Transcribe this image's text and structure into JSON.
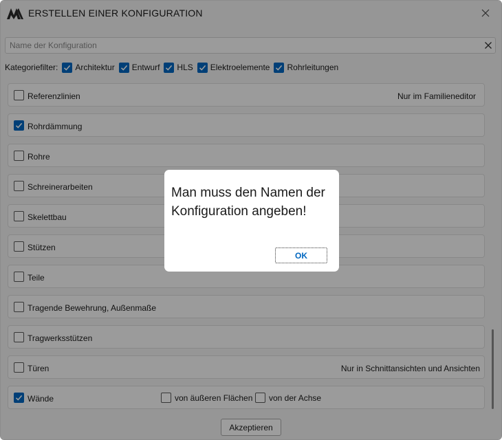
{
  "window": {
    "title": "ERSTELLEN EINER KONFIGURATION"
  },
  "search": {
    "placeholder": "Name der Konfiguration",
    "value": ""
  },
  "filters": {
    "label": "Kategoriefilter:",
    "items": [
      {
        "label": "Architektur",
        "checked": true
      },
      {
        "label": "Entwurf",
        "checked": true
      },
      {
        "label": "HLS",
        "checked": true
      },
      {
        "label": "Elektroelemente",
        "checked": true
      },
      {
        "label": "Rohrleitungen",
        "checked": true
      }
    ]
  },
  "rows": [
    {
      "label": "Referenzlinien",
      "checked": false,
      "note": "Nur im Familieneditor"
    },
    {
      "label": "Rohrdämmung",
      "checked": true,
      "note": ""
    },
    {
      "label": "Rohre",
      "checked": false,
      "note": ""
    },
    {
      "label": "Schreinerarbeiten",
      "checked": false,
      "note": ""
    },
    {
      "label": "Skelettbau",
      "checked": false,
      "note": ""
    },
    {
      "label": "Stützen",
      "checked": false,
      "note": ""
    },
    {
      "label": "Teile",
      "checked": false,
      "note": ""
    },
    {
      "label": "Tragende Bewehrung, Außenmaße",
      "checked": false,
      "note": ""
    },
    {
      "label": "Tragwerksstützen",
      "checked": false,
      "note": ""
    },
    {
      "label": "Türen",
      "checked": false,
      "note": "Nur in Schnittansichten und Ansichten"
    },
    {
      "label": "Wände",
      "checked": true,
      "note": "",
      "options": [
        {
          "label": "von äußeren Flächen",
          "checked": false
        },
        {
          "label": "von der Achse",
          "checked": false
        }
      ]
    }
  ],
  "accept_label": "Akzeptieren",
  "dialog": {
    "message": "Man muss den Namen der Konfiguration angeben!",
    "ok_label": "OK"
  },
  "colors": {
    "accent": "#0067c0",
    "overlay": "rgba(0,0,0,0.38)"
  }
}
